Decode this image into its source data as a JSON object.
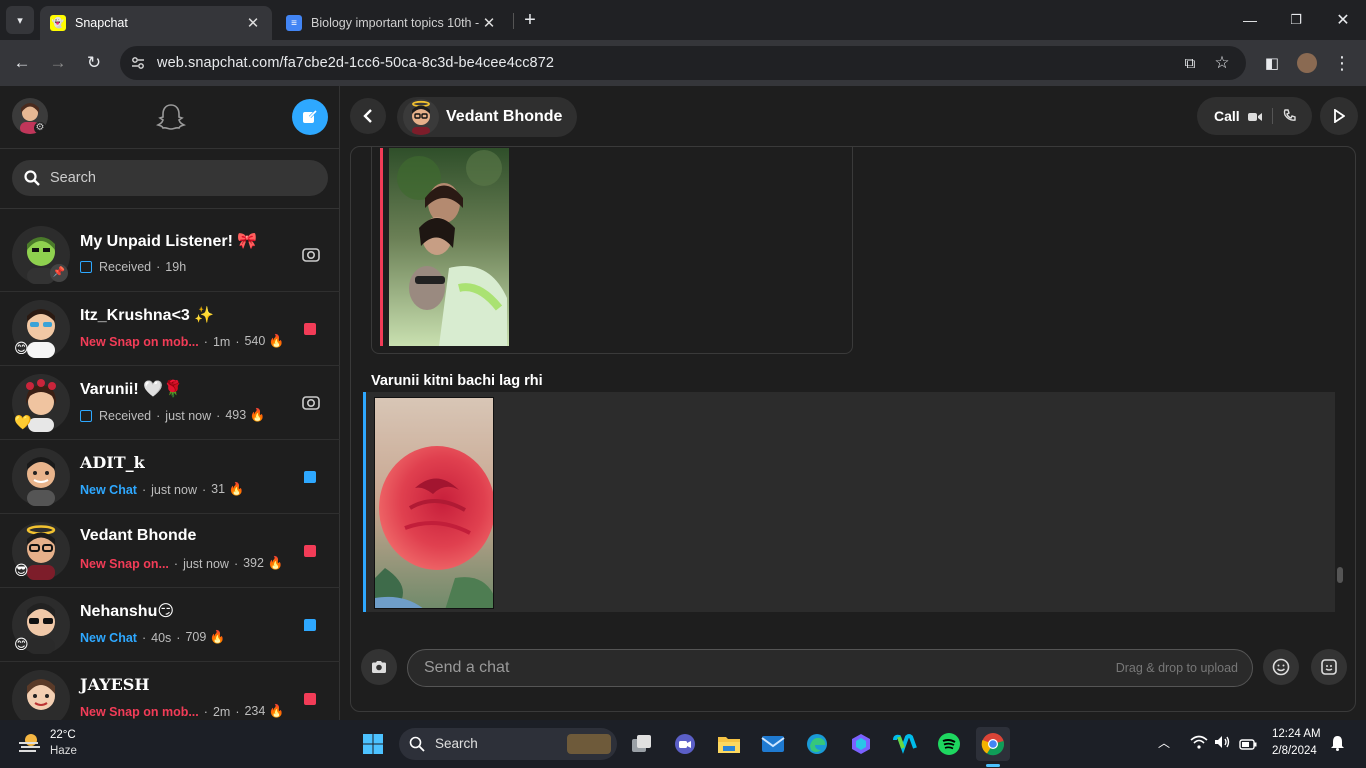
{
  "browser": {
    "tabs": [
      {
        "title": "Snapchat",
        "active": true
      },
      {
        "title": "Biology important topics 10th -",
        "active": false
      }
    ],
    "url": "web.snapchat.com/fa7cbe2d-1cc6-50ca-8c3d-be4cee4cc872"
  },
  "sidebar": {
    "search_placeholder": "Search",
    "chats": [
      {
        "name": "My Unpaid Listener! 🎀",
        "kind": "Received",
        "kind_color": "grey",
        "time": "19h",
        "streak": "",
        "indicator": "camera"
      },
      {
        "name": "Itz_Krushna<3 ✨",
        "kind": "New Snap on mob...",
        "kind_color": "red",
        "time": "1m",
        "streak": "540 🔥",
        "indicator": "red",
        "badge": "😊"
      },
      {
        "name": "Varunii! 🤍🌹",
        "kind": "Received",
        "kind_color": "grey",
        "time": "just now",
        "streak": "493 🔥",
        "indicator": "camera",
        "badge": "💛"
      },
      {
        "name": "ADIT_k",
        "kind": "New Chat",
        "kind_color": "blue",
        "time": "just now",
        "streak": "31 🔥",
        "indicator": "blue"
      },
      {
        "name": "Vedant Bhonde",
        "kind": "New Snap on...",
        "kind_color": "red",
        "time": "just now",
        "streak": "392 🔥",
        "indicator": "red",
        "badge": "😎"
      },
      {
        "name": "Nehanshu😏",
        "kind": "New Chat",
        "kind_color": "blue",
        "time": "40s",
        "streak": "709 🔥",
        "indicator": "blue",
        "badge": "😊"
      },
      {
        "name": "JAYESH",
        "kind": "New Snap on mob...",
        "kind_color": "red",
        "time": "2m",
        "streak": "234 🔥",
        "indicator": "red"
      }
    ]
  },
  "conversation": {
    "contact_name": "Vedant Bhonde",
    "call_label": "Call",
    "message_text": "Varunii kitni bachi lag rhi",
    "input_placeholder": "Send a chat",
    "drag_hint": "Drag & drop to upload"
  },
  "taskbar": {
    "weather_temp": "22°C",
    "weather_desc": "Haze",
    "search_label": "Search",
    "time": "12:24 AM",
    "date": "2/8/2024"
  },
  "colors": {
    "accent_red": "#f23c57",
    "accent_blue": "#2ea8ff",
    "snap_yellow": "#fffc00"
  }
}
